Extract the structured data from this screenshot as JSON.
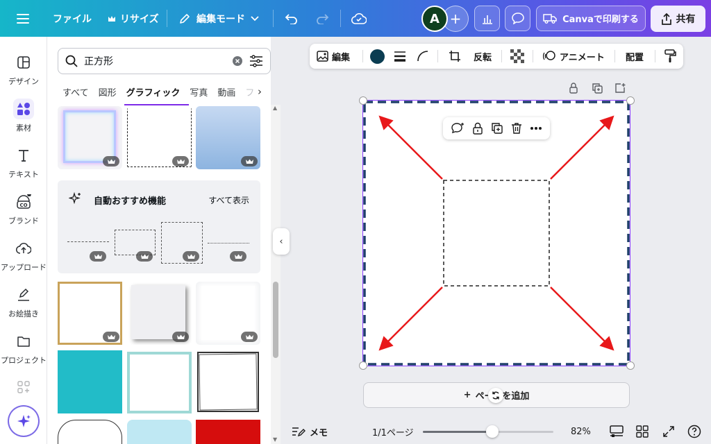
{
  "topbar": {
    "menu_icon": "hamburger-icon",
    "file_label": "ファイル",
    "resize_label": "リサイズ",
    "edit_mode_label": "編集モード",
    "avatar_initial": "A",
    "print_label": "Canvaで印刷する",
    "share_label": "共有",
    "accent": "#7b3fe4"
  },
  "rail": {
    "items": [
      {
        "label": "デザイン",
        "icon": "layout-icon"
      },
      {
        "label": "素材",
        "icon": "shapes-icon"
      },
      {
        "label": "テキスト",
        "icon": "text-icon"
      },
      {
        "label": "ブランド",
        "icon": "brand-icon"
      },
      {
        "label": "アップロード",
        "icon": "upload-icon"
      },
      {
        "label": "お絵描き",
        "icon": "draw-icon"
      },
      {
        "label": "プロジェクト",
        "icon": "folder-icon"
      }
    ],
    "active_index": 1
  },
  "panel": {
    "search_value": "正方形",
    "tabs": [
      "すべて",
      "図形",
      "グラフィック",
      "写真",
      "動画",
      "フ"
    ],
    "active_tab": "グラフィック",
    "recommend_title": "自動おすすめ機能",
    "recommend_all": "すべて表示"
  },
  "toolbar": {
    "edit_label": "編集",
    "flip_label": "反転",
    "animate_label": "アニメート",
    "position_label": "配置",
    "color_swatch": "#0b3d52"
  },
  "canvas": {
    "add_page_label": "ページを追加",
    "border_color": "#1f3f6b",
    "arrow_color": "#e8181a"
  },
  "bottombar": {
    "notes_label": "メモ",
    "page_label": "1/1ページ",
    "zoom_label": "82%",
    "zoom_fraction": 0.53
  }
}
